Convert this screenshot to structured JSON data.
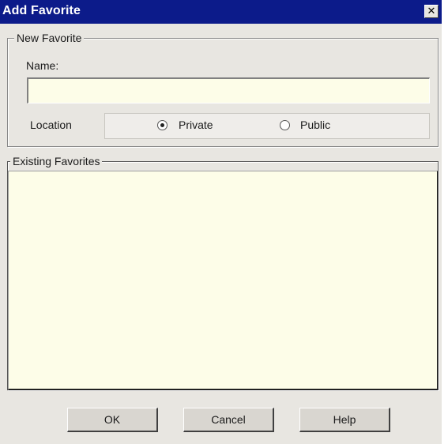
{
  "window": {
    "title": "Add Favorite",
    "close_glyph": "✕"
  },
  "new_favorite": {
    "legend": "New Favorite",
    "name_label": "Name:",
    "name_value": "",
    "location_label": "Location",
    "location_options": [
      {
        "label": "Private",
        "selected": true
      },
      {
        "label": "Public",
        "selected": false
      }
    ]
  },
  "existing_favorites": {
    "legend": "Existing Favorites",
    "items": []
  },
  "buttons": {
    "ok": "OK",
    "cancel": "Cancel",
    "help": "Help"
  },
  "colors": {
    "titlebar": "#0c1b8a",
    "dialog_bg": "#e8e6e1",
    "field_bg": "#fdfde8"
  },
  "icons": {
    "close": "close-icon",
    "radio_checked": "radio-checked-icon",
    "radio_unchecked": "radio-unchecked-icon"
  }
}
